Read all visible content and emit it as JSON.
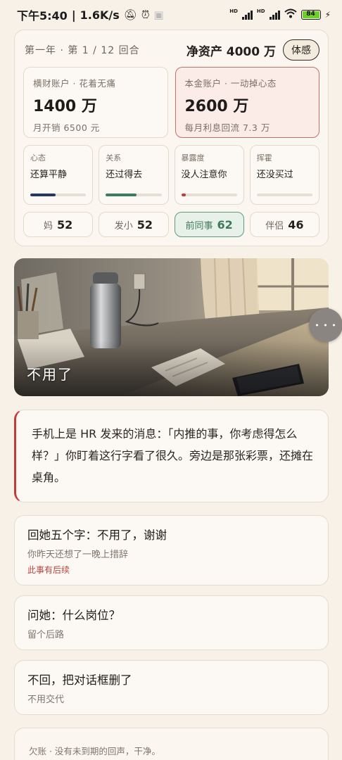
{
  "status_bar": {
    "time": "下午5:40",
    "speed": "1.6K/s",
    "hd1": "HD",
    "hd2": "HD",
    "battery": "84"
  },
  "top": {
    "round": "第一年 · 第 1 / 12 回合",
    "net_worth": "净资产 4000 万",
    "sense_button": "体感",
    "accounts": [
      {
        "label": "横财账户 · 花着无痛",
        "amount": "1400 万",
        "sub": "月开销 6500 元"
      },
      {
        "label": "本金账户 · 一动掉心态",
        "amount": "2600 万",
        "sub": "每月利息回流 7.3 万"
      }
    ],
    "stats": [
      {
        "label": "心态",
        "value": "还算平静",
        "level": 0.45,
        "color": "#223a63"
      },
      {
        "label": "关系",
        "value": "还过得去",
        "level": 0.55,
        "color": "#3d7a5f"
      },
      {
        "label": "暴露度",
        "value": "没人注意你",
        "level": 0.08,
        "color": "#c23b3b"
      },
      {
        "label": "挥霍",
        "value": "还没买过",
        "level": 0.0,
        "color": "#8a7f72"
      }
    ],
    "people": [
      {
        "name": "妈",
        "score": "52"
      },
      {
        "name": "发小",
        "score": "52"
      },
      {
        "name": "前同事",
        "score": "62"
      },
      {
        "name": "伴侣",
        "score": "46"
      }
    ]
  },
  "scene": {
    "caption": "不用了",
    "more_label": "• • •"
  },
  "narrative": "手机上是 HR 发来的消息：「内推的事，你考虑得怎么样？」你盯着这行字看了很久。旁边是那张彩票，还摊在桌角。",
  "choices": [
    {
      "title": "回她五个字：不用了，谢谢",
      "sub": "你昨天还想了一晚上措辞",
      "note": "此事有后续"
    },
    {
      "title": "问她：什么岗位？",
      "sub": "留个后路"
    },
    {
      "title": "不回，把对话框删了",
      "sub": "不用交代"
    }
  ],
  "debt": "欠账 · 没有未到期的回声，干净。",
  "colors": {
    "background": "#f7f1e7",
    "accent_red": "#c23b3b",
    "accent_green": "#3f7a5a"
  }
}
